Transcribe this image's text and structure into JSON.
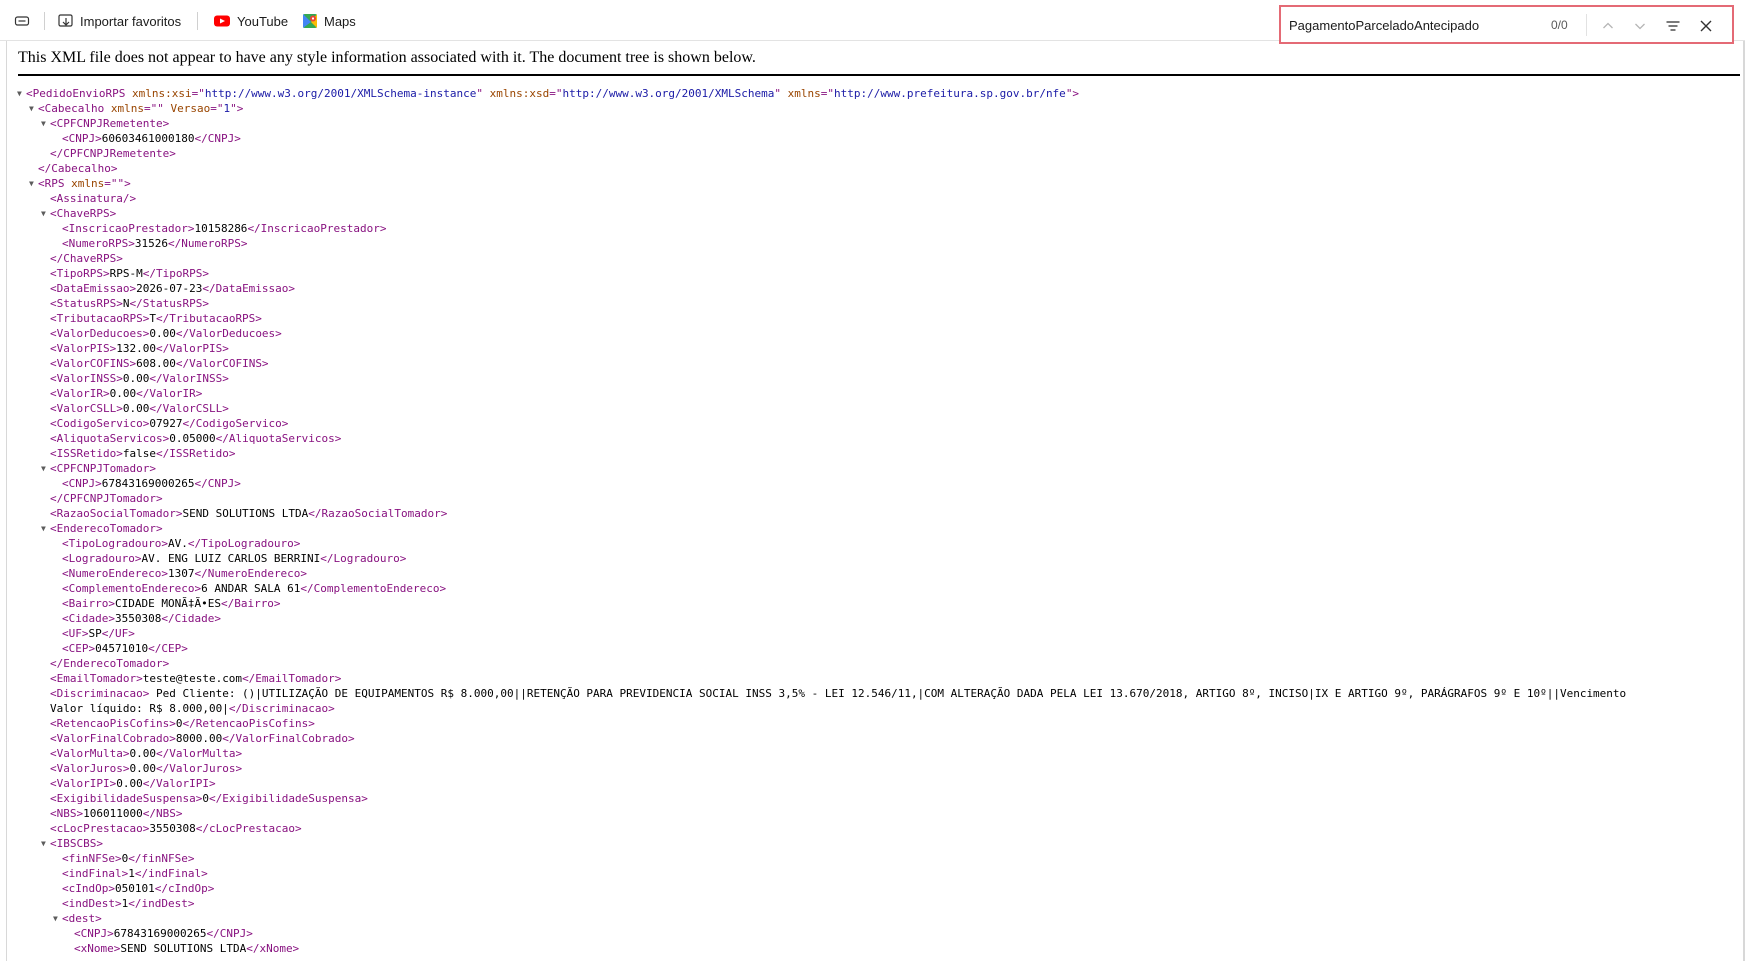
{
  "favorites": {
    "items": [
      {
        "label": "Importar favoritos",
        "icon": "import-favorites-icon"
      },
      {
        "label": "YouTube",
        "icon": "youtube-icon"
      },
      {
        "label": "Maps",
        "icon": "maps-icon"
      }
    ]
  },
  "find": {
    "query": "PagamentoParceladoAntecipado",
    "count": "0/0"
  },
  "notice": "This XML file does not appear to have any style information associated with it. The document tree is shown below.",
  "colors": {
    "tag": "#881280",
    "attr_name": "#994500",
    "attr_value": "#1a1aa6",
    "find_border": "#e46a75"
  },
  "xml_lines": [
    {
      "indent": 0,
      "toggle": true,
      "tokens": [
        [
          "t",
          "<PedidoEnvioRPS "
        ],
        [
          "a",
          "xmlns:xsi"
        ],
        [
          "t",
          "=\""
        ],
        [
          "v",
          "http://www.w3.org/2001/XMLSchema-instance"
        ],
        [
          "t",
          "\" "
        ],
        [
          "a",
          "xmlns:xsd"
        ],
        [
          "t",
          "=\""
        ],
        [
          "v",
          "http://www.w3.org/2001/XMLSchema"
        ],
        [
          "t",
          "\" "
        ],
        [
          "a",
          "xmlns"
        ],
        [
          "t",
          "=\""
        ],
        [
          "v",
          "http://www.prefeitura.sp.gov.br/nfe"
        ],
        [
          "t",
          "\">"
        ]
      ]
    },
    {
      "indent": 1,
      "toggle": true,
      "tokens": [
        [
          "t",
          "<Cabecalho "
        ],
        [
          "a",
          "xmlns"
        ],
        [
          "t",
          "=\""
        ],
        [
          "v",
          ""
        ],
        [
          "t",
          "\" "
        ],
        [
          "a",
          "Versao"
        ],
        [
          "t",
          "=\""
        ],
        [
          "v",
          "1"
        ],
        [
          "t",
          "\">"
        ]
      ]
    },
    {
      "indent": 2,
      "toggle": true,
      "tokens": [
        [
          "t",
          "<CPFCNPJRemetente>"
        ]
      ]
    },
    {
      "indent": 3,
      "toggle": false,
      "tokens": [
        [
          "t",
          "<CNPJ>"
        ],
        [
          "x",
          "60603461000180"
        ],
        [
          "t",
          "</CNPJ>"
        ]
      ]
    },
    {
      "indent": 2,
      "toggle": false,
      "tokens": [
        [
          "t",
          "</CPFCNPJRemetente>"
        ]
      ]
    },
    {
      "indent": 1,
      "toggle": false,
      "tokens": [
        [
          "t",
          "</Cabecalho>"
        ]
      ]
    },
    {
      "indent": 1,
      "toggle": true,
      "tokens": [
        [
          "t",
          "<RPS "
        ],
        [
          "a",
          "xmlns"
        ],
        [
          "t",
          "=\""
        ],
        [
          "v",
          ""
        ],
        [
          "t",
          "\">"
        ]
      ]
    },
    {
      "indent": 2,
      "toggle": false,
      "tokens": [
        [
          "t",
          "<Assinatura/>"
        ]
      ]
    },
    {
      "indent": 2,
      "toggle": true,
      "tokens": [
        [
          "t",
          "<ChaveRPS>"
        ]
      ]
    },
    {
      "indent": 3,
      "toggle": false,
      "tokens": [
        [
          "t",
          "<InscricaoPrestador>"
        ],
        [
          "x",
          "10158286"
        ],
        [
          "t",
          "</InscricaoPrestador>"
        ]
      ]
    },
    {
      "indent": 3,
      "toggle": false,
      "tokens": [
        [
          "t",
          "<NumeroRPS>"
        ],
        [
          "x",
          "31526"
        ],
        [
          "t",
          "</NumeroRPS>"
        ]
      ]
    },
    {
      "indent": 2,
      "toggle": false,
      "tokens": [
        [
          "t",
          "</ChaveRPS>"
        ]
      ]
    },
    {
      "indent": 2,
      "toggle": false,
      "tokens": [
        [
          "t",
          "<TipoRPS>"
        ],
        [
          "x",
          "RPS-M"
        ],
        [
          "t",
          "</TipoRPS>"
        ]
      ]
    },
    {
      "indent": 2,
      "toggle": false,
      "tokens": [
        [
          "t",
          "<DataEmissao>"
        ],
        [
          "x",
          "2026-07-23"
        ],
        [
          "t",
          "</DataEmissao>"
        ]
      ]
    },
    {
      "indent": 2,
      "toggle": false,
      "tokens": [
        [
          "t",
          "<StatusRPS>"
        ],
        [
          "x",
          "N"
        ],
        [
          "t",
          "</StatusRPS>"
        ]
      ]
    },
    {
      "indent": 2,
      "toggle": false,
      "tokens": [
        [
          "t",
          "<TributacaoRPS>"
        ],
        [
          "x",
          "T"
        ],
        [
          "t",
          "</TributacaoRPS>"
        ]
      ]
    },
    {
      "indent": 2,
      "toggle": false,
      "tokens": [
        [
          "t",
          "<ValorDeducoes>"
        ],
        [
          "x",
          "0.00"
        ],
        [
          "t",
          "</ValorDeducoes>"
        ]
      ]
    },
    {
      "indent": 2,
      "toggle": false,
      "tokens": [
        [
          "t",
          "<ValorPIS>"
        ],
        [
          "x",
          "132.00"
        ],
        [
          "t",
          "</ValorPIS>"
        ]
      ]
    },
    {
      "indent": 2,
      "toggle": false,
      "tokens": [
        [
          "t",
          "<ValorCOFINS>"
        ],
        [
          "x",
          "608.00"
        ],
        [
          "t",
          "</ValorCOFINS>"
        ]
      ]
    },
    {
      "indent": 2,
      "toggle": false,
      "tokens": [
        [
          "t",
          "<ValorINSS>"
        ],
        [
          "x",
          "0.00"
        ],
        [
          "t",
          "</ValorINSS>"
        ]
      ]
    },
    {
      "indent": 2,
      "toggle": false,
      "tokens": [
        [
          "t",
          "<ValorIR>"
        ],
        [
          "x",
          "0.00"
        ],
        [
          "t",
          "</ValorIR>"
        ]
      ]
    },
    {
      "indent": 2,
      "toggle": false,
      "tokens": [
        [
          "t",
          "<ValorCSLL>"
        ],
        [
          "x",
          "0.00"
        ],
        [
          "t",
          "</ValorCSLL>"
        ]
      ]
    },
    {
      "indent": 2,
      "toggle": false,
      "tokens": [
        [
          "t",
          "<CodigoServico>"
        ],
        [
          "x",
          "07927"
        ],
        [
          "t",
          "</CodigoServico>"
        ]
      ]
    },
    {
      "indent": 2,
      "toggle": false,
      "tokens": [
        [
          "t",
          "<AliquotaServicos>"
        ],
        [
          "x",
          "0.05000"
        ],
        [
          "t",
          "</AliquotaServicos>"
        ]
      ]
    },
    {
      "indent": 2,
      "toggle": false,
      "tokens": [
        [
          "t",
          "<ISSRetido>"
        ],
        [
          "x",
          "false"
        ],
        [
          "t",
          "</ISSRetido>"
        ]
      ]
    },
    {
      "indent": 2,
      "toggle": true,
      "tokens": [
        [
          "t",
          "<CPFCNPJTomador>"
        ]
      ]
    },
    {
      "indent": 3,
      "toggle": false,
      "tokens": [
        [
          "t",
          "<CNPJ>"
        ],
        [
          "x",
          "67843169000265"
        ],
        [
          "t",
          "</CNPJ>"
        ]
      ]
    },
    {
      "indent": 2,
      "toggle": false,
      "tokens": [
        [
          "t",
          "</CPFCNPJTomador>"
        ]
      ]
    },
    {
      "indent": 2,
      "toggle": false,
      "tokens": [
        [
          "t",
          "<RazaoSocialTomador>"
        ],
        [
          "x",
          "SEND SOLUTIONS LTDA"
        ],
        [
          "t",
          "</RazaoSocialTomador>"
        ]
      ]
    },
    {
      "indent": 2,
      "toggle": true,
      "tokens": [
        [
          "t",
          "<EnderecoTomador>"
        ]
      ]
    },
    {
      "indent": 3,
      "toggle": false,
      "tokens": [
        [
          "t",
          "<TipoLogradouro>"
        ],
        [
          "x",
          "AV."
        ],
        [
          "t",
          "</TipoLogradouro>"
        ]
      ]
    },
    {
      "indent": 3,
      "toggle": false,
      "tokens": [
        [
          "t",
          "<Logradouro>"
        ],
        [
          "x",
          "AV. ENG LUIZ CARLOS BERRINI"
        ],
        [
          "t",
          "</Logradouro>"
        ]
      ]
    },
    {
      "indent": 3,
      "toggle": false,
      "tokens": [
        [
          "t",
          "<NumeroEndereco>"
        ],
        [
          "x",
          "1307"
        ],
        [
          "t",
          "</NumeroEndereco>"
        ]
      ]
    },
    {
      "indent": 3,
      "toggle": false,
      "tokens": [
        [
          "t",
          "<ComplementoEndereco>"
        ],
        [
          "x",
          "6 ANDAR SALA 61"
        ],
        [
          "t",
          "</ComplementoEndereco>"
        ]
      ]
    },
    {
      "indent": 3,
      "toggle": false,
      "tokens": [
        [
          "t",
          "<Bairro>"
        ],
        [
          "x",
          "CIDADE MONÃ‡Ã•ES"
        ],
        [
          "t",
          "</Bairro>"
        ]
      ]
    },
    {
      "indent": 3,
      "toggle": false,
      "tokens": [
        [
          "t",
          "<Cidade>"
        ],
        [
          "x",
          "3550308"
        ],
        [
          "t",
          "</Cidade>"
        ]
      ]
    },
    {
      "indent": 3,
      "toggle": false,
      "tokens": [
        [
          "t",
          "<UF>"
        ],
        [
          "x",
          "SP"
        ],
        [
          "t",
          "</UF>"
        ]
      ]
    },
    {
      "indent": 3,
      "toggle": false,
      "tokens": [
        [
          "t",
          "<CEP>"
        ],
        [
          "x",
          "04571010"
        ],
        [
          "t",
          "</CEP>"
        ]
      ]
    },
    {
      "indent": 2,
      "toggle": false,
      "tokens": [
        [
          "t",
          "</EnderecoTomador>"
        ]
      ]
    },
    {
      "indent": 2,
      "toggle": false,
      "tokens": [
        [
          "t",
          "<EmailTomador>"
        ],
        [
          "x",
          "teste@teste.com"
        ],
        [
          "t",
          "</EmailTomador>"
        ]
      ]
    },
    {
      "indent": 2,
      "toggle": false,
      "tokens": [
        [
          "t",
          "<Discriminacao>"
        ],
        [
          "x",
          " Ped Cliente: ()|UTILIZAÇÃO DE EQUIPAMENTOS R$ 8.000,00||RETENÇÃO PARA PREVIDENCIA SOCIAL INSS 3,5% - LEI 12.546/11,|COM ALTERAÇÃO DADA PELA LEI 13.670/2018, ARTIGO 8º, INCISO|IX E ARTIGO 9º, PARÁGRAFOS 9º E 10º||Vencimento"
        ]
      ]
    },
    {
      "indent": 2,
      "toggle": false,
      "tokens": [
        [
          "x",
          "Valor líquido: R$ 8.000,00|"
        ],
        [
          "t",
          "</Discriminacao>"
        ]
      ]
    },
    {
      "indent": 2,
      "toggle": false,
      "tokens": [
        [
          "t",
          "<RetencaoPisCofins>"
        ],
        [
          "x",
          "0"
        ],
        [
          "t",
          "</RetencaoPisCofins>"
        ]
      ]
    },
    {
      "indent": 2,
      "toggle": false,
      "tokens": [
        [
          "t",
          "<ValorFinalCobrado>"
        ],
        [
          "x",
          "8000.00"
        ],
        [
          "t",
          "</ValorFinalCobrado>"
        ]
      ]
    },
    {
      "indent": 2,
      "toggle": false,
      "tokens": [
        [
          "t",
          "<ValorMulta>"
        ],
        [
          "x",
          "0.00"
        ],
        [
          "t",
          "</ValorMulta>"
        ]
      ]
    },
    {
      "indent": 2,
      "toggle": false,
      "tokens": [
        [
          "t",
          "<ValorJuros>"
        ],
        [
          "x",
          "0.00"
        ],
        [
          "t",
          "</ValorJuros>"
        ]
      ]
    },
    {
      "indent": 2,
      "toggle": false,
      "tokens": [
        [
          "t",
          "<ValorIPI>"
        ],
        [
          "x",
          "0.00"
        ],
        [
          "t",
          "</ValorIPI>"
        ]
      ]
    },
    {
      "indent": 2,
      "toggle": false,
      "tokens": [
        [
          "t",
          "<ExigibilidadeSuspensa>"
        ],
        [
          "x",
          "0"
        ],
        [
          "t",
          "</ExigibilidadeSuspensa>"
        ]
      ]
    },
    {
      "indent": 2,
      "toggle": false,
      "tokens": [
        [
          "t",
          "<NBS>"
        ],
        [
          "x",
          "106011000"
        ],
        [
          "t",
          "</NBS>"
        ]
      ]
    },
    {
      "indent": 2,
      "toggle": false,
      "tokens": [
        [
          "t",
          "<cLocPrestacao>"
        ],
        [
          "x",
          "3550308"
        ],
        [
          "t",
          "</cLocPrestacao>"
        ]
      ]
    },
    {
      "indent": 2,
      "toggle": true,
      "tokens": [
        [
          "t",
          "<IBSCBS>"
        ]
      ]
    },
    {
      "indent": 3,
      "toggle": false,
      "tokens": [
        [
          "t",
          "<finNFSe>"
        ],
        [
          "x",
          "0"
        ],
        [
          "t",
          "</finNFSe>"
        ]
      ]
    },
    {
      "indent": 3,
      "toggle": false,
      "tokens": [
        [
          "t",
          "<indFinal>"
        ],
        [
          "x",
          "1"
        ],
        [
          "t",
          "</indFinal>"
        ]
      ]
    },
    {
      "indent": 3,
      "toggle": false,
      "tokens": [
        [
          "t",
          "<cIndOp>"
        ],
        [
          "x",
          "050101"
        ],
        [
          "t",
          "</cIndOp>"
        ]
      ]
    },
    {
      "indent": 3,
      "toggle": false,
      "tokens": [
        [
          "t",
          "<indDest>"
        ],
        [
          "x",
          "1"
        ],
        [
          "t",
          "</indDest>"
        ]
      ]
    },
    {
      "indent": 3,
      "toggle": true,
      "tokens": [
        [
          "t",
          "<dest>"
        ]
      ]
    },
    {
      "indent": 4,
      "toggle": false,
      "tokens": [
        [
          "t",
          "<CNPJ>"
        ],
        [
          "x",
          "67843169000265"
        ],
        [
          "t",
          "</CNPJ>"
        ]
      ]
    },
    {
      "indent": 4,
      "toggle": false,
      "tokens": [
        [
          "t",
          "<xNome>"
        ],
        [
          "x",
          "SEND SOLUTIONS LTDA"
        ],
        [
          "t",
          "</xNome>"
        ]
      ]
    }
  ]
}
